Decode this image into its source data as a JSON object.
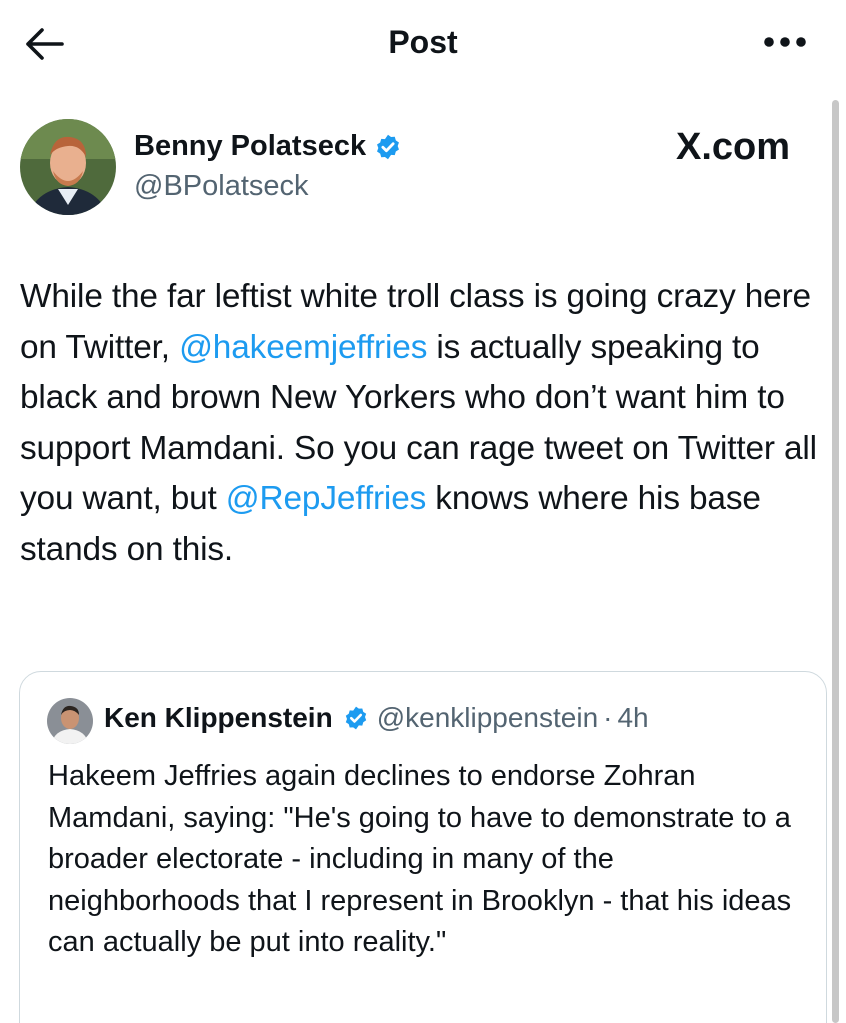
{
  "header": {
    "title": "Post",
    "back_icon": "arrow-left-icon",
    "more_icon": "more-dots-icon"
  },
  "post": {
    "author": {
      "name": "Benny Polatseck",
      "handle": "@BPolatseck",
      "verified": true
    },
    "watermark": "X.com",
    "text": {
      "part1": "While the far leftist white troll class is going crazy here on Twitter, ",
      "mention1": "@hakeemjeffries",
      "part2": " is actually speaking to black and brown New Yorkers who don’t want him to support Mamdani. So you can rage tweet on Twitter all you want, but ",
      "mention2": "@RepJeffries",
      "part3": " knows where his base stands on this."
    }
  },
  "quote": {
    "author": {
      "name": "Ken Klippenstein",
      "handle": "@kenklippenstein",
      "separator": "·",
      "time": "4h",
      "verified": true
    },
    "text": "Hakeem Jeffries again declines to endorse Zohran Mamdani, saying: \"He's going to have to demonstrate to a broader electorate - including in many of the neighborhoods that I represent in Brooklyn - that his ideas can actually be put into reality.\""
  },
  "colors": {
    "accent": "#1d9bf0",
    "text": "#0f1419",
    "secondary": "#536471",
    "border": "#cfd9de"
  }
}
